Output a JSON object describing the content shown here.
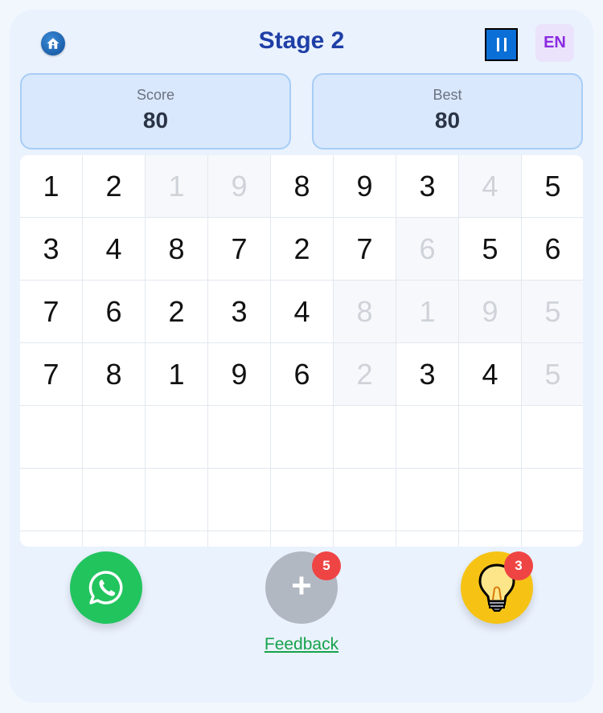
{
  "header": {
    "title": "Stage 2",
    "language": "EN"
  },
  "stats": {
    "score_label": "Score",
    "score_value": "80",
    "best_label": "Best",
    "best_value": "80"
  },
  "board": {
    "columns": 9,
    "rows": [
      [
        {
          "v": "1",
          "used": false
        },
        {
          "v": "2",
          "used": false
        },
        {
          "v": "1",
          "used": true
        },
        {
          "v": "9",
          "used": true
        },
        {
          "v": "8",
          "used": false
        },
        {
          "v": "9",
          "used": false
        },
        {
          "v": "3",
          "used": false
        },
        {
          "v": "4",
          "used": true
        },
        {
          "v": "5",
          "used": false
        }
      ],
      [
        {
          "v": "3",
          "used": false
        },
        {
          "v": "4",
          "used": false
        },
        {
          "v": "8",
          "used": false
        },
        {
          "v": "7",
          "used": false
        },
        {
          "v": "2",
          "used": false
        },
        {
          "v": "7",
          "used": false
        },
        {
          "v": "6",
          "used": true
        },
        {
          "v": "5",
          "used": false
        },
        {
          "v": "6",
          "used": false
        }
      ],
      [
        {
          "v": "7",
          "used": false
        },
        {
          "v": "6",
          "used": false
        },
        {
          "v": "2",
          "used": false
        },
        {
          "v": "3",
          "used": false
        },
        {
          "v": "4",
          "used": false
        },
        {
          "v": "8",
          "used": true
        },
        {
          "v": "1",
          "used": true
        },
        {
          "v": "9",
          "used": true
        },
        {
          "v": "5",
          "used": true
        }
      ],
      [
        {
          "v": "7",
          "used": false
        },
        {
          "v": "8",
          "used": false
        },
        {
          "v": "1",
          "used": false
        },
        {
          "v": "9",
          "used": false
        },
        {
          "v": "6",
          "used": false
        },
        {
          "v": "2",
          "used": true
        },
        {
          "v": "3",
          "used": false
        },
        {
          "v": "4",
          "used": false
        },
        {
          "v": "5",
          "used": true
        }
      ],
      [
        {
          "v": "",
          "used": false
        },
        {
          "v": "",
          "used": false
        },
        {
          "v": "",
          "used": false
        },
        {
          "v": "",
          "used": false
        },
        {
          "v": "",
          "used": false
        },
        {
          "v": "",
          "used": false
        },
        {
          "v": "",
          "used": false
        },
        {
          "v": "",
          "used": false
        },
        {
          "v": "",
          "used": false
        }
      ],
      [
        {
          "v": "",
          "used": false
        },
        {
          "v": "",
          "used": false
        },
        {
          "v": "",
          "used": false
        },
        {
          "v": "",
          "used": false
        },
        {
          "v": "",
          "used": false
        },
        {
          "v": "",
          "used": false
        },
        {
          "v": "",
          "used": false
        },
        {
          "v": "",
          "used": false
        },
        {
          "v": "",
          "used": false
        }
      ],
      [
        {
          "v": "",
          "used": false
        },
        {
          "v": "",
          "used": false
        },
        {
          "v": "",
          "used": false
        },
        {
          "v": "",
          "used": false
        },
        {
          "v": "",
          "used": false
        },
        {
          "v": "",
          "used": false
        },
        {
          "v": "",
          "used": false
        },
        {
          "v": "",
          "used": false
        },
        {
          "v": "",
          "used": false
        }
      ]
    ]
  },
  "actions": {
    "add_badge": "5",
    "hint_badge": "3",
    "feedback_label": "Feedback"
  },
  "icons": {
    "home": "home-icon",
    "pause": "pause-icon",
    "whatsapp": "whatsapp-icon",
    "add": "plus-icon",
    "hint": "lightbulb-icon"
  },
  "colors": {
    "title": "#1e3fa6",
    "whatsapp": "#22c45e",
    "hint": "#f6c315",
    "badge": "#ef4444",
    "feedback": "#16a34a"
  }
}
